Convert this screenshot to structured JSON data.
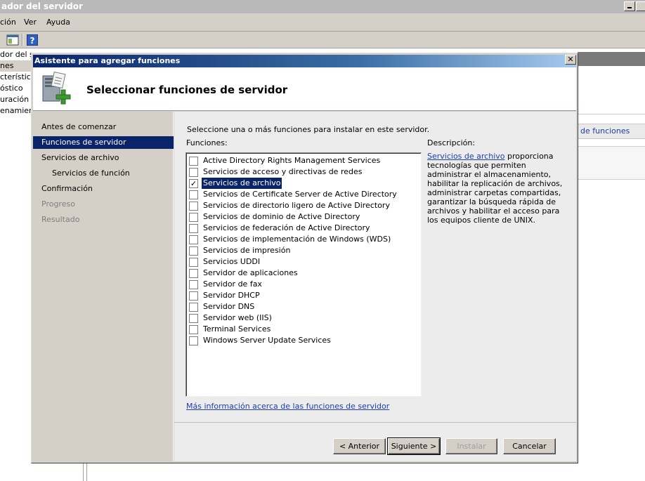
{
  "app": {
    "title": "ador del servidor",
    "menu": [
      "ción",
      "Ver",
      "Ayuda"
    ],
    "tree": [
      "dor del se",
      "nes",
      "cterísticas",
      "óstico",
      "uración",
      "enamiento"
    ],
    "right_link": "de funciones"
  },
  "dialog": {
    "title": "Asistente para agregar funciones",
    "close": "✕",
    "header_title": "Seleccionar funciones de servidor",
    "nav": [
      {
        "label": "Antes de comenzar",
        "state": "normal"
      },
      {
        "label": "Funciones de servidor",
        "state": "active"
      },
      {
        "label": "Servicios de archivo",
        "state": "normal"
      },
      {
        "label": "Servicios de función",
        "state": "sub"
      },
      {
        "label": "Confirmación",
        "state": "normal"
      },
      {
        "label": "Progreso",
        "state": "disabled"
      },
      {
        "label": "Resultado",
        "state": "disabled"
      }
    ],
    "intro": "Seleccione una o más funciones para instalar en este servidor.",
    "roles_label": "Funciones:",
    "roles": [
      {
        "label": "Active Directory Rights Management Services",
        "checked": false
      },
      {
        "label": "Servicios de acceso y directivas de redes",
        "checked": false
      },
      {
        "label": "Servicios de archivo",
        "checked": true
      },
      {
        "label": "Servicios de Certificate Server de Active Directory",
        "checked": false
      },
      {
        "label": "Servicios de directorio ligero de Active Directory",
        "checked": false
      },
      {
        "label": "Servicios de dominio de Active Directory",
        "checked": false
      },
      {
        "label": "Servicios de federación de Active Directory",
        "checked": false
      },
      {
        "label": "Servicios de implementación de Windows (WDS)",
        "checked": false
      },
      {
        "label": "Servicios de impresión",
        "checked": false
      },
      {
        "label": "Servicios UDDI",
        "checked": false
      },
      {
        "label": "Servidor de aplicaciones",
        "checked": false
      },
      {
        "label": "Servidor de fax",
        "checked": false
      },
      {
        "label": "Servidor DHCP",
        "checked": false
      },
      {
        "label": "Servidor DNS",
        "checked": false
      },
      {
        "label": "Servidor web (IIS)",
        "checked": false
      },
      {
        "label": "Terminal Services",
        "checked": false
      },
      {
        "label": "Windows Server Update Services",
        "checked": false
      }
    ],
    "selected_role_index": 2,
    "description_label": "Descripción:",
    "description_link": "Servicios de archivo",
    "description_text": " proporciona tecnologías que permiten administrar el almacenamiento, habilitar la replicación de archivos, administrar carpetas compartidas, garantizar la búsqueda rápida de archivos y habilitar el acceso para los equipos cliente de UNIX.",
    "more_info_link": "Más información acerca de las funciones de servidor",
    "buttons": {
      "back": "< Anterior",
      "next": "Siguiente >",
      "install": "Instalar",
      "cancel": "Cancelar"
    }
  }
}
